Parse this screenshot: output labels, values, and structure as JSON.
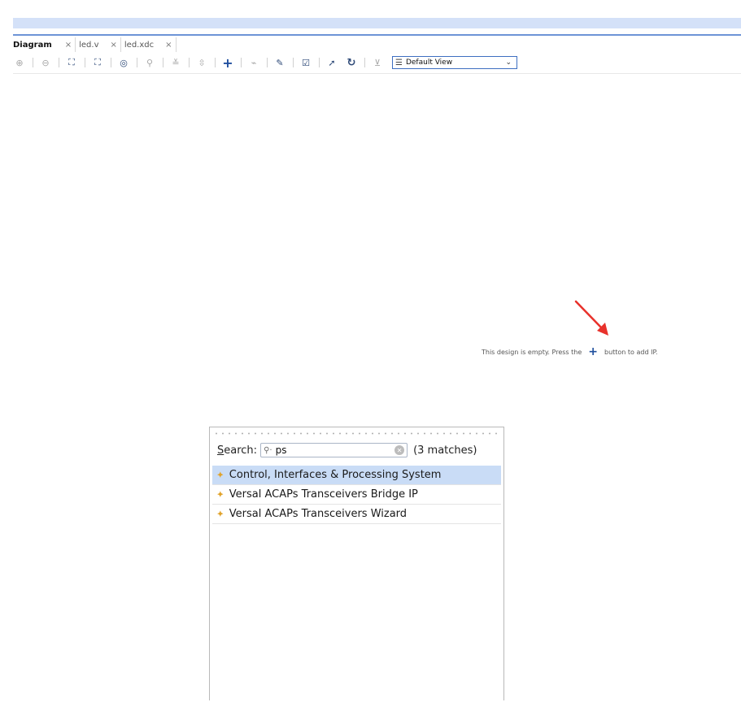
{
  "tabs": [
    {
      "label": "Diagram",
      "active": true
    },
    {
      "label": "led.v",
      "active": false
    },
    {
      "label": "led.xdc",
      "active": false
    }
  ],
  "tab_close_glyph": "×",
  "toolbar": {
    "icons": [
      "zoom-in-icon",
      "zoom-out-icon",
      "fit-view-icon",
      "fit-selection-icon",
      "center-icon",
      "search-icon",
      "collapse-icon",
      "expand-icon",
      "add-ip-icon",
      "route-icon",
      "wrench-icon",
      "validate-icon",
      "pin-icon",
      "refresh-icon",
      "regenerate-icon"
    ],
    "view_select": {
      "selected": "Default View"
    }
  },
  "canvas": {
    "hint_before": "This design is empty. Press the",
    "hint_after": "button to add IP.",
    "arrow_color": "#e8312b"
  },
  "popup": {
    "search_label_accel": "S",
    "search_label_rest": "earch:",
    "search_value": "ps",
    "matches": "(3 matches)",
    "results": [
      {
        "label": "Control, Interfaces & Processing System",
        "selected": true
      },
      {
        "label": "Versal ACAPs Transceivers Bridge IP",
        "selected": false
      },
      {
        "label": "Versal ACAPs Transceivers Wizard",
        "selected": false
      }
    ]
  },
  "colors": {
    "accent": "#6d94d6",
    "selection": "#c9dcf6",
    "ip_icon": "#e0a22a"
  }
}
